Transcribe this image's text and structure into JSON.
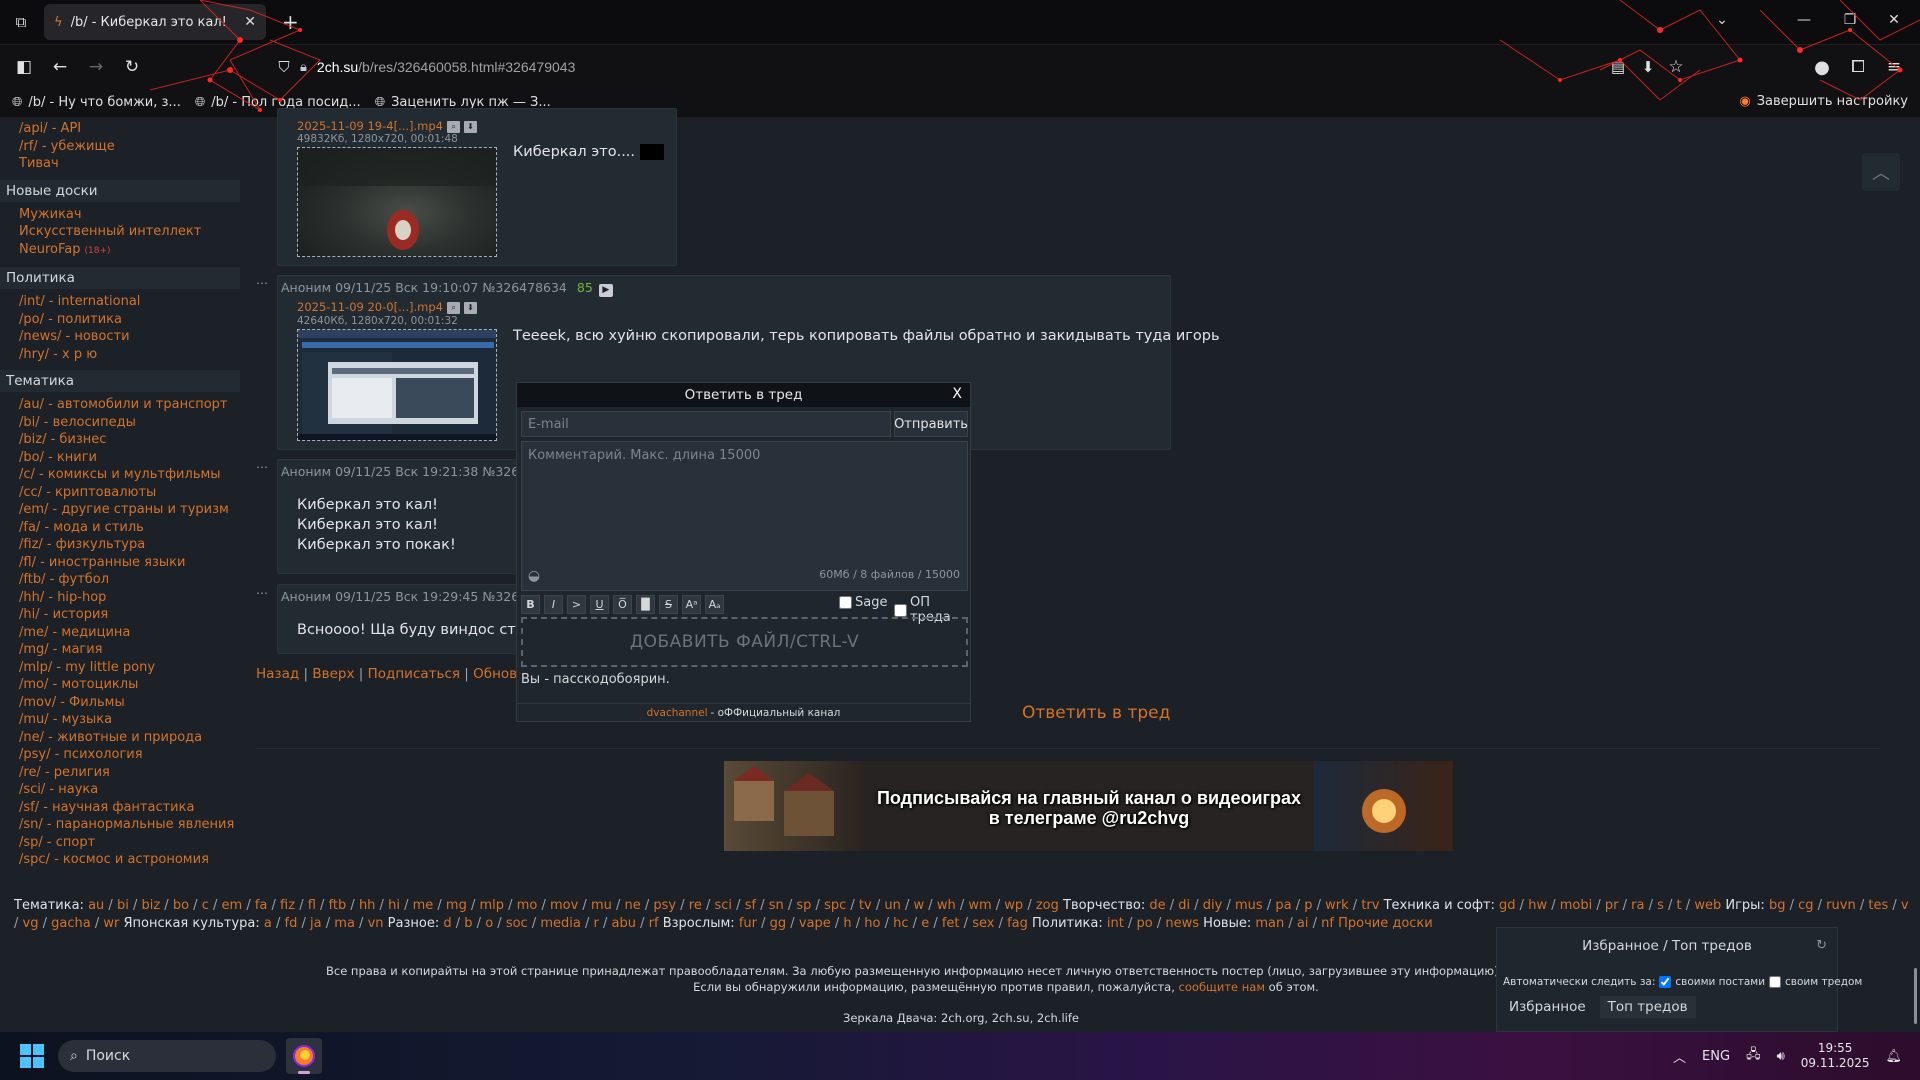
{
  "browser": {
    "tab_title": "/b/ - Киберкал это кал!",
    "url_domain": "2ch.su",
    "url_rest": "/b/res/326460058.html#326479043",
    "bookmarks": [
      {
        "label": "/b/ - Ну что бомжи, з..."
      },
      {
        "label": "/b/ - Пол года посид..."
      },
      {
        "label": "Заценить лук пж — З..."
      }
    ],
    "finish_setup": "Завершить настройку"
  },
  "sidebar": {
    "top_links": [
      "/api/ - API",
      "/rf/ - убежище",
      "Тивач"
    ],
    "sections": [
      {
        "title": "Новые доски",
        "links": [
          {
            "label": "Мужикач"
          },
          {
            "label": "Искусственный интеллект"
          },
          {
            "label": "NeuroFap",
            "badge": "(18+)"
          }
        ]
      },
      {
        "title": "Политика",
        "links": [
          {
            "label": "/int/ - international"
          },
          {
            "label": "/po/ - политика"
          },
          {
            "label": "/news/ - новости"
          },
          {
            "label": "/hry/ - х р ю"
          }
        ]
      },
      {
        "title": "Тематика",
        "links": [
          {
            "label": "/au/ - автомобили и транспорт"
          },
          {
            "label": "/bi/ - велосипеды"
          },
          {
            "label": "/biz/ - бизнес"
          },
          {
            "label": "/bo/ - книги"
          },
          {
            "label": "/c/ - комиксы и мультфильмы"
          },
          {
            "label": "/cc/ - криптовалюты"
          },
          {
            "label": "/em/ - другие страны и туризм"
          },
          {
            "label": "/fa/ - мода и стиль"
          },
          {
            "label": "/fiz/ - физкультура"
          },
          {
            "label": "/fl/ - иностранные языки"
          },
          {
            "label": "/ftb/ - футбол"
          },
          {
            "label": "/hh/ - hip-hop"
          },
          {
            "label": "/hi/ - история"
          },
          {
            "label": "/me/ - медицина"
          },
          {
            "label": "/mg/ - магия"
          },
          {
            "label": "/mlp/ - my little pony"
          },
          {
            "label": "/mo/ - мотоциклы"
          },
          {
            "label": "/mov/ - Фильмы"
          },
          {
            "label": "/mu/ - музыка"
          },
          {
            "label": "/ne/ - животные и природа"
          },
          {
            "label": "/psy/ - психология"
          },
          {
            "label": "/re/ - религия"
          },
          {
            "label": "/sci/ - наука"
          },
          {
            "label": "/sf/ - научная фантастика"
          },
          {
            "label": "/sn/ - паранормальные явления"
          },
          {
            "label": "/sp/ - спорт"
          },
          {
            "label": "/spc/ - космос и астрономия"
          }
        ]
      }
    ]
  },
  "posts": [
    {
      "file_name": "2025-11-09 19-4[...].mp4",
      "file_info": "49832Кб, 1280x720, 00:01:48",
      "text": "Киберкал это....",
      "has_censor_block": true
    },
    {
      "author": "Аноним",
      "date": "09/11/25 Вск 19:10:07",
      "num": "№326478634",
      "likes": "85",
      "file_name": "2025-11-09 20-0[...].mp4",
      "file_info": "42640Кб, 1280x720, 00:01:32",
      "text": "Тееееk, всю хуйню скопировали, терь копировать файлы обратно и закидывать туда игорь"
    },
    {
      "author": "Аноним",
      "date": "09/11/25 Вск 19:21:38",
      "num": "№326",
      "text": "Киберкал это кал!\nКиберкал это кал!\nКиберкал это покак!"
    },
    {
      "author": "Аноним",
      "date": "09/11/25 Вск 19:29:45",
      "num": "№326",
      "text": "Всноооо! Ща буду виндос стави"
    }
  ],
  "reply_form": {
    "title": "Ответить в тред",
    "close": "X",
    "email_placeholder": "E-mail",
    "submit": "Отправить",
    "comment_placeholder": "Комментарий. Макс. длина 15000",
    "limits": "60Мб / 8 файлов / 15000",
    "format_buttons": [
      "B",
      "I",
      ">",
      "U",
      "O̅",
      "█",
      "S",
      "Aᵃ",
      "Aₐ"
    ],
    "sage_label": "Sage",
    "op_label": "ОП треда",
    "drop_label": "ДОБАВИТЬ ФАЙЛ/CTRL-V",
    "you_are": "Вы - пасскодобоярин.",
    "footer_link": "dvachannel",
    "footer_text": " - оФФициальный канал"
  },
  "thread_nav": {
    "back": "Назад",
    "up": "Вверх",
    "subscribe": "Подписаться",
    "refresh": "Обновить"
  },
  "reply_link": "Ответить в тред",
  "banner": {
    "line1": "Подписывайся на главный канал о видеоиграх",
    "line2": "в телеграме @ru2chvg"
  },
  "board_list": [
    {
      "cat": "Тематика:",
      "boards": [
        "au",
        "bi",
        "biz",
        "bo",
        "c",
        "em",
        "fa",
        "fiz",
        "fl",
        "ftb",
        "hh",
        "hi",
        "me",
        "mg",
        "mlp",
        "mo",
        "mov",
        "mu",
        "ne",
        "psy",
        "re",
        "sci",
        "sf",
        "sn",
        "sp",
        "spc",
        "tv",
        "un",
        "w",
        "wh",
        "wm",
        "wp",
        "zog"
      ]
    },
    {
      "cat": "Творчество:",
      "boards": [
        "de",
        "di",
        "diy",
        "mus",
        "pa",
        "p",
        "wrk",
        "trv"
      ]
    },
    {
      "cat": "Техника и софт:",
      "boards": [
        "gd",
        "hw",
        "mobi",
        "pr",
        "ra",
        "s",
        "t",
        "web"
      ]
    },
    {
      "cat": "Игры:",
      "boards": [
        "bg",
        "cg",
        "ruvn",
        "tes",
        "v",
        "vg",
        "gacha",
        "wr"
      ]
    },
    {
      "cat": "Японская культура:",
      "boards": [
        "a",
        "fd",
        "ja",
        "ma",
        "vn"
      ]
    },
    {
      "cat": "Разное:",
      "boards": [
        "d",
        "b",
        "o",
        "soc",
        "media",
        "r",
        "abu",
        "rf"
      ]
    },
    {
      "cat": "Взрослым:",
      "boards": [
        "fur",
        "gg",
        "vape",
        "h",
        "ho",
        "hc",
        "e",
        "fet",
        "sex",
        "fag"
      ]
    },
    {
      "cat": "Политика:",
      "boards": [
        "int",
        "po",
        "news"
      ]
    },
    {
      "cat": "Новые:",
      "boards": [
        "man",
        "ai",
        "nf"
      ]
    }
  ],
  "other_boards": "Прочие доски",
  "copyright": {
    "line1": "Все права и копирайты на этой странице принадлежат правообладателям. За любую размещенную информацию несет личную ответственность постер (лицо, загрузившее эту информацию). Все комментарии принадлеж",
    "line2_pre": "Если вы обнаружили информацию, размещённую против правил, пожалуйста, ",
    "line2_link": "сообщите нам",
    "line2_post": " об этом."
  },
  "mirrors": "Зеркала Двача: 2ch.org, 2ch.su, 2ch.life",
  "fav_panel": {
    "title": "Избранное / Топ тредов",
    "auto_label": "Автоматически следить за:",
    "own_posts": "своими постами",
    "own_thread": "своим тредом",
    "tab_fav": "Избранное",
    "tab_top": "Топ тредов"
  },
  "taskbar": {
    "search": "Поиск",
    "lang": "ENG",
    "time": "19:55",
    "date": "09.11.2025"
  }
}
